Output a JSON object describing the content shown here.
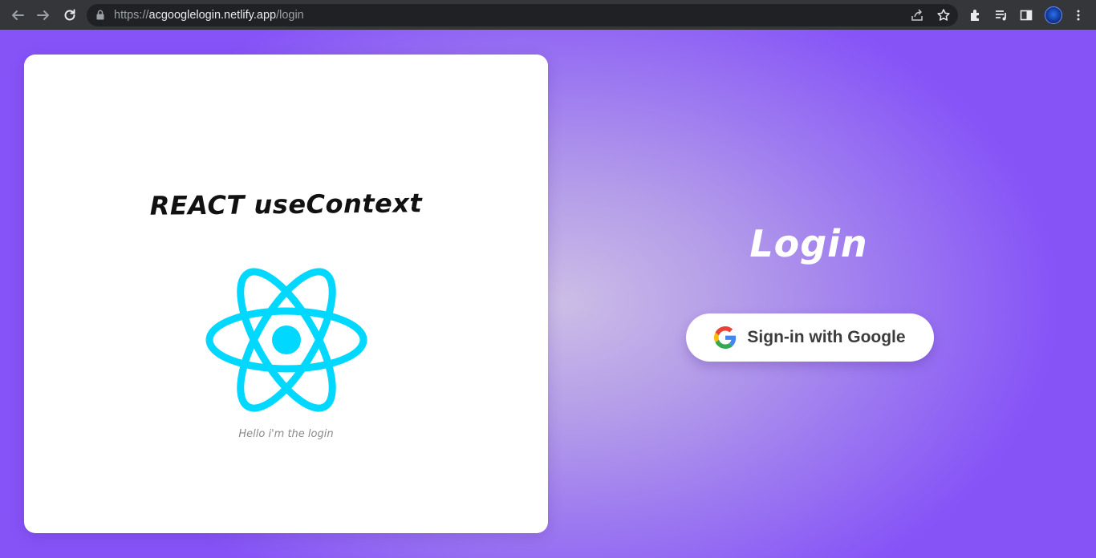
{
  "browser": {
    "url_scheme": "https://",
    "url_host": "acgooglelogin.netlify.app",
    "url_path": "/login",
    "icons": [
      "back-arrow-icon",
      "forward-arrow-icon",
      "reload-icon",
      "lock-icon",
      "share-icon",
      "star-icon",
      "extensions-icon",
      "media-control-icon",
      "side-panel-icon",
      "profile-avatar",
      "kebab-menu-icon"
    ]
  },
  "card": {
    "title": "REACT useContext",
    "subtitle": "Hello i'm the login",
    "logo_color": "#00d8ff"
  },
  "login": {
    "title": "Login",
    "button_label": "Sign-in with Google"
  },
  "colors": {
    "background_edge": "#8653f7",
    "background_center": "#cbbde6",
    "card": "#ffffff"
  }
}
